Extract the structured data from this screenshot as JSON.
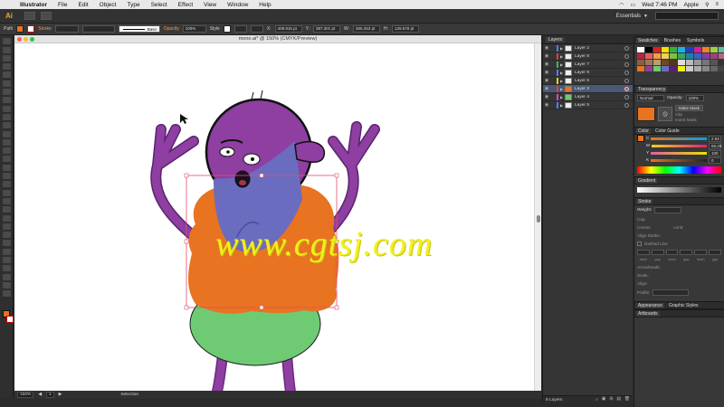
{
  "menubar": {
    "app": "Illustrator",
    "items": [
      "File",
      "Edit",
      "Object",
      "Type",
      "Select",
      "Effect",
      "View",
      "Window",
      "Help"
    ],
    "clock": "Wed 7:46 PM",
    "user": "Apple"
  },
  "appbar": {
    "logo": "Ai",
    "workspace": "Essentials"
  },
  "controlbar": {
    "selection_label": "Path",
    "stroke_label": "Stroke",
    "brush_label": "Basic",
    "opacity_label": "Opacity",
    "opacity_value": "100%",
    "style_label": "Style",
    "x_value": "409.915 pt",
    "y_value": "387.301 pt",
    "w_value": "266.253 pt",
    "h_value": "129.678 pt"
  },
  "document": {
    "title": "mono.ai* @ 150% (CMYK/Preview)",
    "zoom": "150%",
    "artboard": "1",
    "tool": "Selection",
    "watermark": "www.cgtsj.com"
  },
  "colors": {
    "fill": "#e87320",
    "purple": "#8e3fa1",
    "orange": "#e87320",
    "green": "#6ecb74",
    "blue": "#6a6cc0"
  },
  "layers": {
    "tabs": [
      "Layers"
    ],
    "items": [
      {
        "name": "Layer 2",
        "color": "#4f7dff"
      },
      {
        "name": "Layer 8",
        "color": "#e04040"
      },
      {
        "name": "Layer 7",
        "color": "#34c24a"
      },
      {
        "name": "Layer 9",
        "color": "#4f7dff"
      },
      {
        "name": "Layer 6",
        "color": "#e0d030"
      },
      {
        "name": "Layer 3",
        "color": "#e04040"
      },
      {
        "name": "Layer 4",
        "color": "#c050d0"
      },
      {
        "name": "Layer 5",
        "color": "#4f7dff"
      }
    ],
    "count": "8 Layers"
  },
  "swatches_panel": {
    "tabs": [
      "Swatches",
      "Brushes",
      "Symbols"
    ]
  },
  "transparency": {
    "title": "Transparency",
    "mode": "Normal",
    "opacity_label": "Opacity:",
    "opacity_value": "100%",
    "make_mask": "Make Mask",
    "clip": "Clip",
    "invert_mask": "Invert Mask"
  },
  "color_panel": {
    "tabs": [
      "Color",
      "Color Guide"
    ],
    "channels": [
      {
        "label": "C",
        "value": "2.94",
        "color": "#00a0e0"
      },
      {
        "label": "M",
        "value": "69.29",
        "color": "#e0207a"
      },
      {
        "label": "Y",
        "value": "100",
        "color": "#f2e000"
      },
      {
        "label": "K",
        "value": "0",
        "color": "#222222"
      }
    ]
  },
  "gradient_panel": {
    "title": "Gradient"
  },
  "stroke_panel": {
    "title": "Stroke",
    "weight_label": "Weight:",
    "cap_label": "Cap:",
    "corner_label": "Corner:",
    "limit_label": "Limit:",
    "align_label": "Align Stroke:",
    "dashed_label": "Dashed Line",
    "dash_labels": [
      "dash",
      "gap",
      "dash",
      "gap",
      "dash",
      "gap"
    ],
    "arrowheads_label": "Arrowheads:",
    "scale_label": "Scale:",
    "align2_label": "Align:",
    "profile_label": "Profile:"
  },
  "bottom_tabs": {
    "appearance": "Appearance",
    "graphic_styles": "Graphic Styles",
    "artboards": "Artboards"
  }
}
